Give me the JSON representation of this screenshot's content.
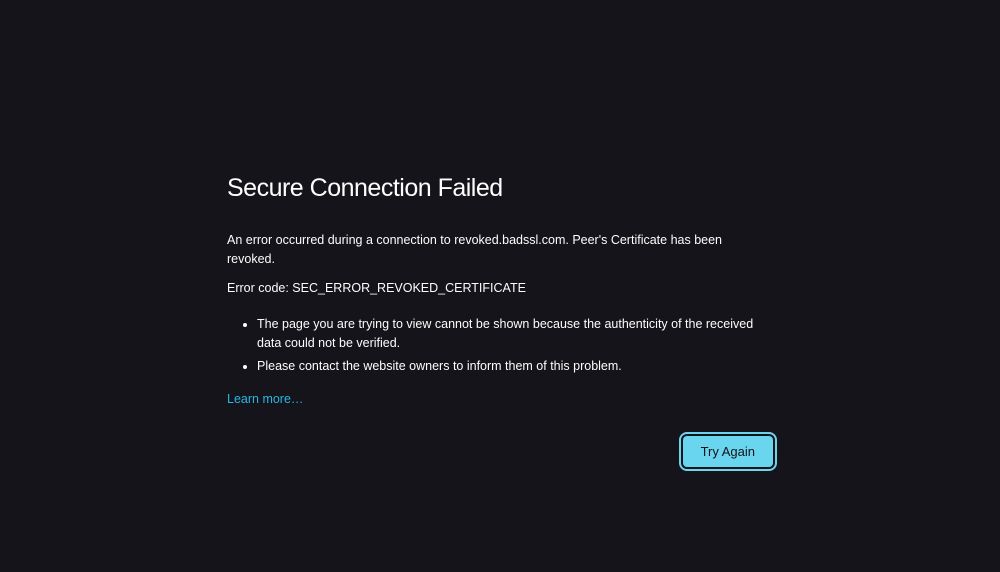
{
  "error": {
    "title": "Secure Connection Failed",
    "message": "An error occurred during a connection to revoked.badssl.com. Peer's Certificate has been revoked.",
    "code_line": "Error code: SEC_ERROR_REVOKED_CERTIFICATE",
    "details": [
      "The page you are trying to view cannot be shown because the authenticity of the received data could not be verified.",
      "Please contact the website owners to inform them of this problem."
    ],
    "learn_more_label": "Learn more…",
    "try_again_label": "Try Again"
  }
}
